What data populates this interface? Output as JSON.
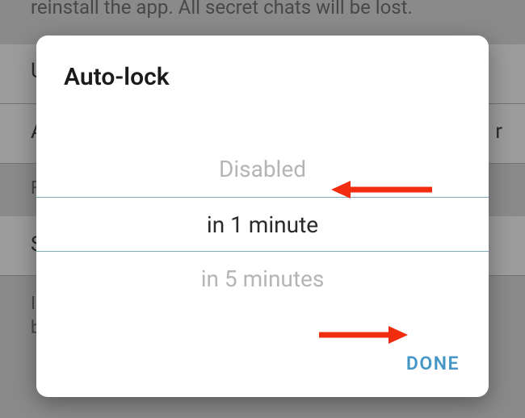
{
  "background": {
    "text_fragment": "reinstall the app. All secret chats will be lost."
  },
  "dialog": {
    "title": "Auto-lock",
    "options": {
      "prev": "Disabled",
      "selected": "in 1 minute",
      "next": "in 5 minutes"
    },
    "done_label": "DONE"
  },
  "annotations": {
    "arrow_color": "#f22c0f"
  }
}
